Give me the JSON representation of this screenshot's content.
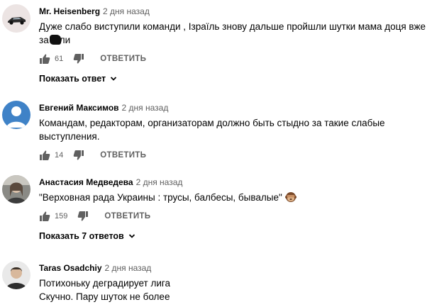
{
  "comments": [
    {
      "author": "Mr. Heisenberg",
      "time": "2 дня назад",
      "text_lines": [
        "Дуже слабо виступили команди , Ізраїль знову дальше пройшли шутки мама доця вже",
        "за",
        "ли"
      ],
      "likes": "61",
      "reply_label": "ОТВЕТИТЬ",
      "show_replies": "Показать ответ",
      "avatar": "sports-car-avatar"
    },
    {
      "author": "Евгений Максимов",
      "time": "2 дня назад",
      "text_lines": [
        "Командам, редакторам, организаторам должно быть стыдно за такие слабые",
        "выступления."
      ],
      "likes": "14",
      "reply_label": "ОТВЕТИТЬ",
      "avatar": "default-user-avatar"
    },
    {
      "author": "Анастасия Медведева",
      "time": "2 дня назад",
      "text_lines": [
        "\"Верховная рада Украины : трусы, балбесы, бывалые\""
      ],
      "emoji": "see-no-evil-monkey-emoji",
      "likes": "159",
      "reply_label": "ОТВЕТИТЬ",
      "show_replies": "Показать 7 ответов",
      "avatar": "photo-avatar"
    },
    {
      "author": "Taras Osadchiy",
      "time": "2 дня назад",
      "text_lines": [
        "Потихоньку деградирует лига",
        "Скучно. Пару шуток не более"
      ],
      "avatar": "man-photo-avatar"
    }
  ],
  "colors": {
    "text": "#030303",
    "secondary": "#606060",
    "default_avatar": "#3f82c7"
  }
}
